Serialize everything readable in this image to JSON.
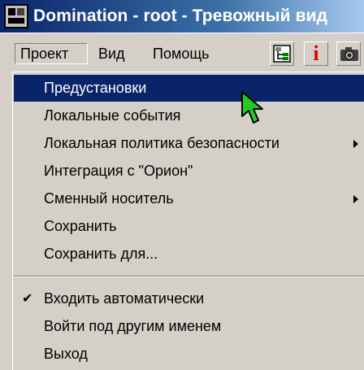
{
  "window": {
    "title": "Domination - root - Тревожный вид"
  },
  "menubar": {
    "items": [
      {
        "label": "Проект"
      },
      {
        "label": "Вид"
      },
      {
        "label": "Помощь"
      }
    ],
    "toolbar": {
      "info_glyph": "i"
    }
  },
  "dropdown": {
    "items": [
      {
        "label": "Предустановки",
        "selected": true
      },
      {
        "label": "Локальные события"
      },
      {
        "label": "Локальная политика безопасности",
        "submenu": true
      },
      {
        "label": "Интеграция с \"Орион\""
      },
      {
        "label": "Сменный носитель",
        "submenu": true
      },
      {
        "label": "Сохранить"
      },
      {
        "label": "Сохранить для..."
      },
      {
        "label": "Входить автоматически",
        "checked": true,
        "check_glyph": "✔"
      },
      {
        "label": "Войти под другим именем"
      },
      {
        "label": "Выход"
      }
    ]
  },
  "colors": {
    "title_bar": "#0a246a",
    "selection": "#0a246a",
    "cursor": "#22cc22"
  },
  "icons": [
    "app-icon",
    "tree-icon",
    "info-icon",
    "camera-icon",
    "submenu-arrow-icon",
    "check-icon",
    "cursor-arrow-icon"
  ]
}
